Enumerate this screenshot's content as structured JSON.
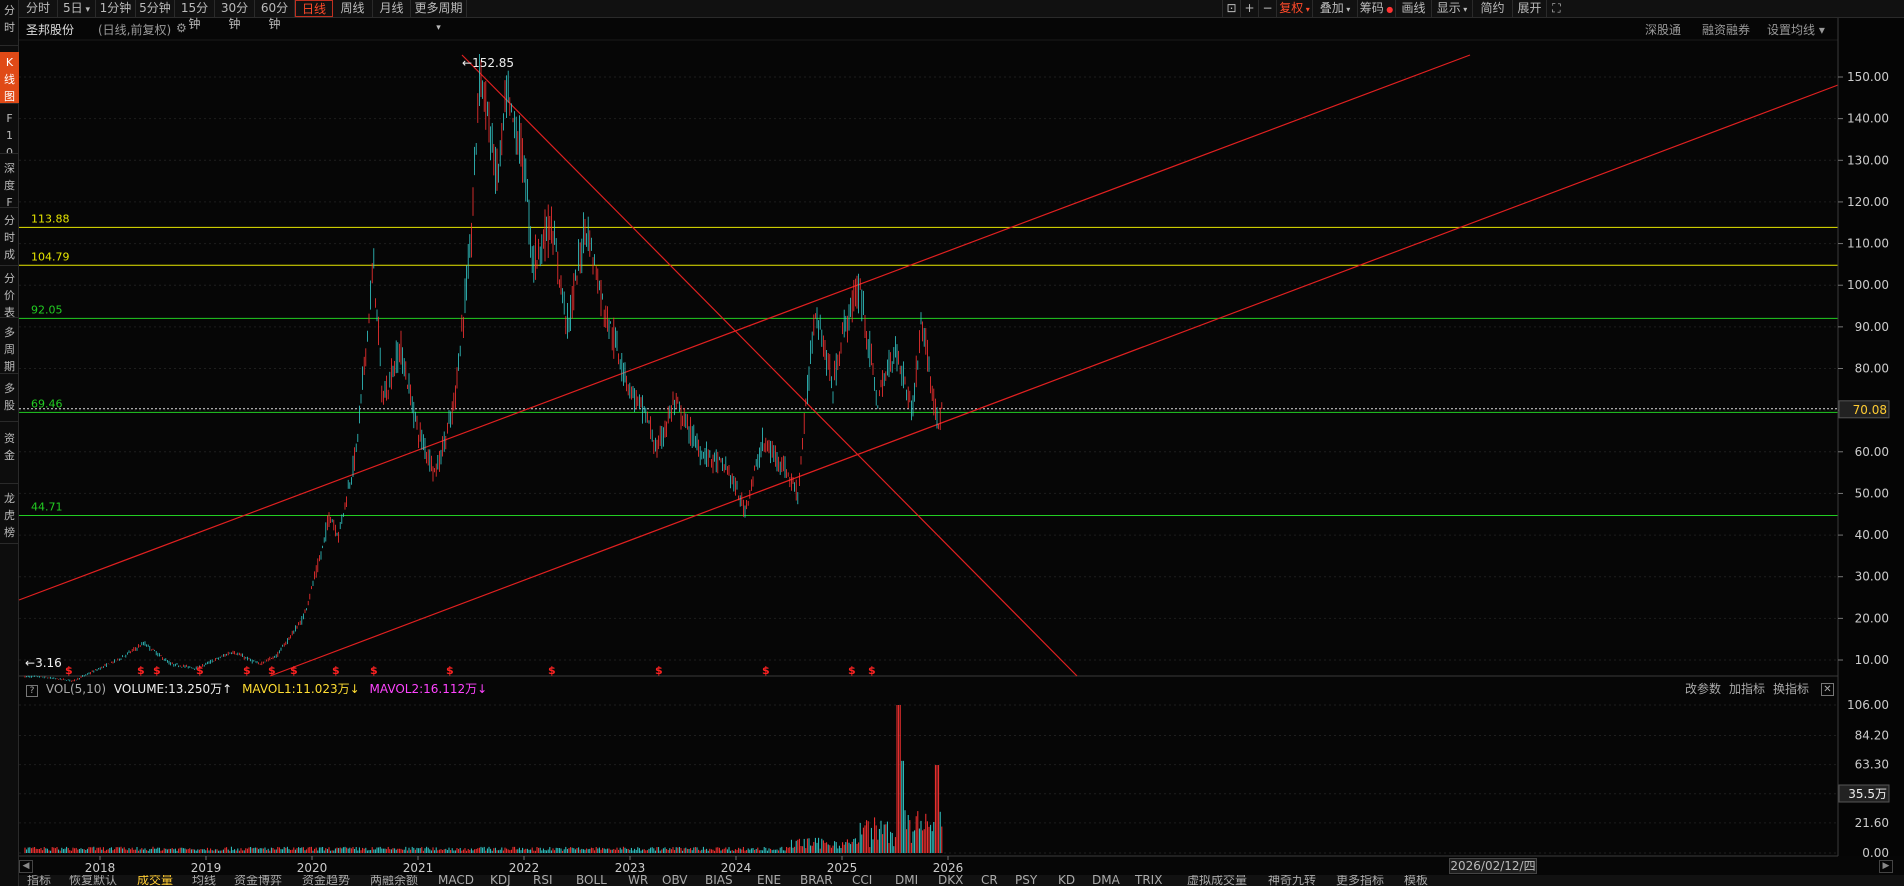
{
  "stock": {
    "name": "圣邦股份",
    "mode": "(日线,前复权)"
  },
  "left_tabs": [
    {
      "label": "分时"
    },
    {
      "label": "K线图"
    },
    {
      "label": "F10资料"
    },
    {
      "label": "深度F9"
    },
    {
      "label": "分时成交"
    },
    {
      "label": "分价表"
    },
    {
      "label": "多周期"
    },
    {
      "label": "多股"
    },
    {
      "label": "资金"
    },
    {
      "label": "龙虎榜"
    }
  ],
  "periods": [
    "分时",
    "5日",
    "1分钟",
    "5分钟",
    "15分钟",
    "30分钟",
    "60分钟",
    "日线",
    "周线",
    "月线",
    "更多周期"
  ],
  "active_period": "日线",
  "toolbar_right": [
    "复权",
    "叠加",
    "筹码",
    "画线",
    "显示",
    "简约",
    "展开"
  ],
  "title_links": [
    "深股通",
    "融资融券",
    "设置均线"
  ],
  "levels": [
    {
      "value": "113.88",
      "color": "#e6e600"
    },
    {
      "value": "104.79",
      "color": "#e6e600"
    },
    {
      "value": "92.05",
      "color": "#22cc22"
    },
    {
      "value": "69.46",
      "color": "#22cc22"
    },
    {
      "value": "44.71",
      "color": "#22cc22"
    }
  ],
  "annotations": {
    "high": "152.85",
    "low": "3.16",
    "current_price": "70.08"
  },
  "volume_header": {
    "name": "VOL(5,10)",
    "volume": "VOLUME:13.250万",
    "mavol1": "MAVOL1:11.023万",
    "mavol2": "MAVOL2:16.112万",
    "links": [
      "改参数",
      "加指标",
      "换指标"
    ]
  },
  "volume_current": "35.5万",
  "date_box": "2026/02/12/四",
  "bottom_tabs": [
    "指标",
    "恢复默认",
    "成交量",
    "均线",
    "资金博弈",
    "资金趋势",
    "两融余额",
    "MACD",
    "KDJ",
    "RSI",
    "BOLL",
    "WR",
    "OBV",
    "BIAS",
    "ENE",
    "BRAR",
    "CCI",
    "DMI",
    "DKX",
    "CR",
    "PSY",
    "KD",
    "DMA",
    "TRIX",
    "虚拟成交量",
    "神奇九转",
    "更多指标",
    "模板"
  ],
  "colors": {
    "up": "#ff3333",
    "down": "#33cccc",
    "trendline": "#e02020",
    "accent": "#e04a17"
  },
  "chart_data": {
    "type": "candlestick",
    "x_ticks": [
      "2018",
      "2019",
      "2020",
      "2021",
      "2022",
      "2023",
      "2024",
      "2025",
      "2026"
    ],
    "y_ticks": [
      "150.00",
      "140.00",
      "130.00",
      "120.00",
      "110.00",
      "100.00",
      "90.00",
      "80.00",
      "70.00",
      "60.00",
      "50.00",
      "40.00",
      "30.00",
      "20.00",
      "10.00"
    ],
    "ylim": [
      0,
      156
    ],
    "price_path": [
      [
        "2017-06",
        6
      ],
      [
        "2017-10",
        5
      ],
      [
        "2018-03",
        10
      ],
      [
        "2018-06",
        14
      ],
      [
        "2018-09",
        9
      ],
      [
        "2018-12",
        8
      ],
      [
        "2019-04",
        12
      ],
      [
        "2019-07",
        9
      ],
      [
        "2019-09",
        11
      ],
      [
        "2019-10",
        14
      ],
      [
        "2019-12",
        20
      ],
      [
        "2020-02",
        35
      ],
      [
        "2020-03",
        45
      ],
      [
        "2020-04",
        40
      ],
      [
        "2020-06",
        60
      ],
      [
        "2020-08",
        105
      ],
      [
        "2020-09",
        72
      ],
      [
        "2020-11",
        85
      ],
      [
        "2021-01",
        65
      ],
      [
        "2021-03",
        55
      ],
      [
        "2021-05",
        70
      ],
      [
        "2021-07",
        110
      ],
      [
        "2021-08",
        152.85
      ],
      [
        "2021-10",
        125
      ],
      [
        "2021-11",
        145
      ],
      [
        "2022-01",
        130
      ],
      [
        "2022-02",
        105
      ],
      [
        "2022-04",
        115
      ],
      [
        "2022-06",
        90
      ],
      [
        "2022-08",
        115
      ],
      [
        "2022-10",
        95
      ],
      [
        "2023-01",
        75
      ],
      [
        "2023-03",
        68
      ],
      [
        "2023-04",
        60
      ],
      [
        "2023-06",
        72
      ],
      [
        "2023-09",
        60
      ],
      [
        "2023-12",
        56
      ],
      [
        "2024-02",
        46
      ],
      [
        "2024-04",
        62
      ],
      [
        "2024-06",
        58
      ],
      [
        "2024-08",
        50
      ],
      [
        "2024-10",
        95
      ],
      [
        "2024-12",
        75
      ],
      [
        "2025-01",
        88
      ],
      [
        "2025-03",
        100
      ],
      [
        "2025-05",
        72
      ],
      [
        "2025-07",
        85
      ],
      [
        "2025-09",
        70
      ],
      [
        "2025-10",
        92
      ],
      [
        "2025-12",
        65
      ],
      [
        "2026-01",
        82
      ],
      [
        "2026-02",
        70
      ]
    ],
    "volume_ticks": [
      "106.00",
      "84.20",
      "63.30",
      "42.40",
      "21.60",
      "0.00"
    ],
    "volume_ylim": [
      0,
      110
    ]
  }
}
